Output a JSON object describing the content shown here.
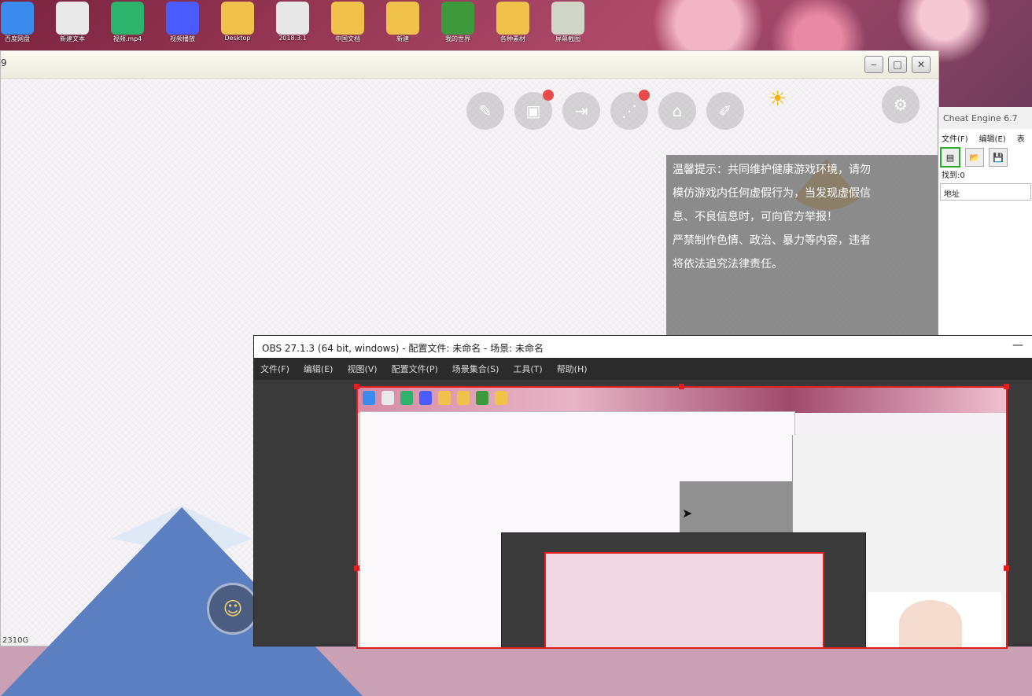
{
  "desktop": {
    "icons": [
      {
        "name": "baidu-netdisk-icon",
        "label": "百度网盘",
        "color": "#3b8bef"
      },
      {
        "name": "document-icon",
        "label": "新建文本",
        "color": "#e9e9e9"
      },
      {
        "name": "mp4-file-icon",
        "label": "视频.mp4",
        "color": "#2db36b"
      },
      {
        "name": "video-player-icon",
        "label": "视频播放",
        "color": "#4a5cff"
      },
      {
        "name": "folder-icon",
        "label": "Desktop",
        "color": "#f0c24b"
      },
      {
        "name": "java-icon",
        "label": "2018.3.1",
        "color": "#e8e8e8"
      },
      {
        "name": "folder-icon",
        "label": "中国文档",
        "color": "#f0c24b"
      },
      {
        "name": "folder-icon",
        "label": "新建",
        "color": "#f0c24b"
      },
      {
        "name": "minecraft-icon",
        "label": "我的世界",
        "color": "#3c9a3c"
      },
      {
        "name": "folder-icon",
        "label": "各种素材",
        "color": "#f0c24b"
      },
      {
        "name": "image-file-icon",
        "label": "屏幕截图",
        "color": "#cfd6c8"
      }
    ]
  },
  "game_window": {
    "title": "9",
    "controls": {
      "minimize": "‒",
      "maximize": "□",
      "close": "✕"
    },
    "toolbar": [
      {
        "name": "wrench-icon",
        "glyph": "✎",
        "badge": false
      },
      {
        "name": "calendar-icon",
        "glyph": "▣",
        "badge": true
      },
      {
        "name": "export-icon",
        "glyph": "⇥",
        "badge": false
      },
      {
        "name": "share-icon",
        "glyph": "⋰",
        "badge": true
      },
      {
        "name": "home-icon",
        "glyph": "⌂",
        "badge": false
      },
      {
        "name": "edit-icon",
        "glyph": "✐",
        "badge": false
      }
    ],
    "settings_icon": "⚙",
    "sun_icon": "☀",
    "notice_lines": [
      "温馨提示：共同维护健康游戏环境，请勿",
      "模仿游戏内任何虚假行为，当发现虚假信",
      "息、不良信息时，可向官方举报！",
      "严禁制作色情、政治、暴力等内容，违者",
      "将依法追究法律责任。"
    ],
    "emoji_glyph": "☺",
    "bottom_text": "2310G"
  },
  "cheat_engine": {
    "title": "Cheat Engine 6.7",
    "menu": [
      "文件(F)",
      "编辑(E)",
      "表"
    ],
    "tools": [
      {
        "name": "open-process-icon",
        "glyph": "▤"
      },
      {
        "name": "open-file-icon",
        "glyph": "📂"
      },
      {
        "name": "save-icon",
        "glyph": "💾"
      }
    ],
    "found": "找到:0",
    "address_header": "地址"
  },
  "obs": {
    "title": "OBS 27.1.3 (64 bit, windows) - 配置文件: 未命名 - 场景: 未命名",
    "minimize": "—",
    "menu": [
      "文件(F)",
      "编辑(E)",
      "视图(V)",
      "配置文件(P)",
      "场景集合(S)",
      "工具(T)",
      "帮助(H)"
    ]
  },
  "colors": {
    "notice_bg": "#6e6e6e",
    "badge": "#e84a4a",
    "obs_border": "#e02020"
  }
}
